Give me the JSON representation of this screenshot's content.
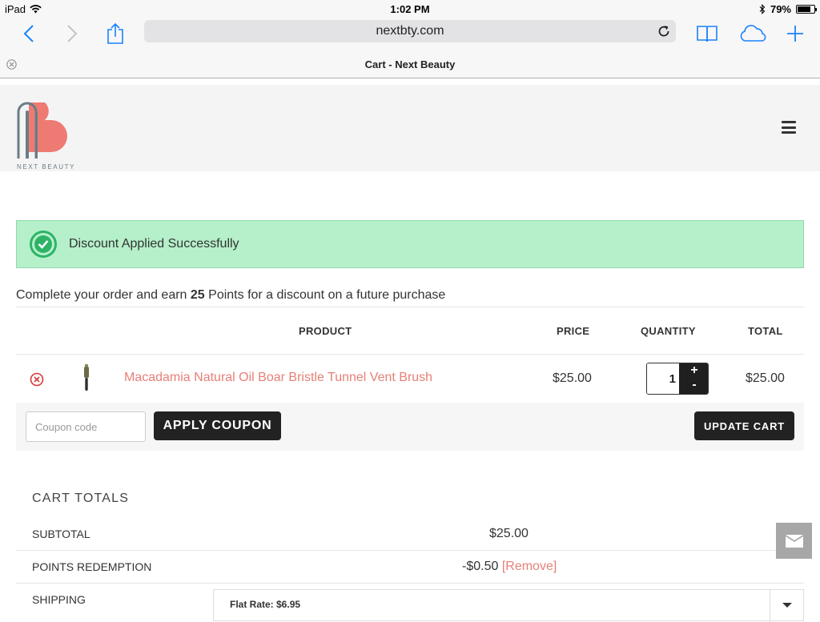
{
  "status_bar": {
    "device": "iPad",
    "time": "1:02 PM",
    "battery": "79%",
    "battery_level": 0.79
  },
  "browser": {
    "url": "nextbty.com",
    "tab_title": "Cart - Next Beauty"
  },
  "site": {
    "logo_text": "NEXT BEAUTY",
    "logo_letters": "NB",
    "brand_color": "#e77f77"
  },
  "notice": {
    "message": "Discount Applied Successfully"
  },
  "points_message": {
    "prefix": "Complete your order and earn ",
    "points": "25",
    "suffix": " Points for a discount on a future purchase"
  },
  "cart_table": {
    "columns": [
      "PRODUCT",
      "PRICE",
      "QUANTITY",
      "TOTAL"
    ],
    "items": [
      {
        "name": "Macadamia Natural Oil Boar Bristle Tunnel Vent Brush",
        "price": "$25.00",
        "quantity": "1",
        "total": "$25.00"
      }
    ],
    "qty_plus": "+",
    "qty_minus": "-"
  },
  "actions": {
    "coupon_placeholder": "Coupon code",
    "apply_label": "APPLY COUPON",
    "update_label": "UPDATE CART"
  },
  "totals": {
    "title": "CART TOTALS",
    "subtotal_label": "SUBTOTAL",
    "subtotal_value": "$25.00",
    "points_label": "POINTS REDEMPTION",
    "points_value": "-$0.50",
    "points_remove": "[Remove]",
    "shipping_label": "SHIPPING",
    "shipping_value": "Flat Rate: $6.95"
  }
}
